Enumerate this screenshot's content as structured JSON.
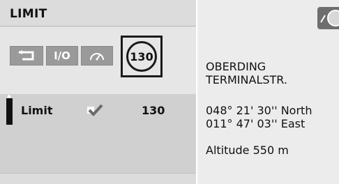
{
  "header": {
    "title": "LIMIT"
  },
  "controls": {
    "io_label": "I/O",
    "sign_value": "130"
  },
  "limit_row": {
    "label": "Limit",
    "value": "130",
    "checked": true
  },
  "location": {
    "street_line1": "OBERDING",
    "street_line2": "TERMINALSTR.",
    "latitude": "048° 21' 30'' North",
    "longitude": "011° 47' 03'' East",
    "altitude": "Altitude 550 m"
  },
  "icons": {
    "back": "back-arrow-icon",
    "speedometer": "speedometer-icon",
    "check": "checkmark-icon",
    "compass": "compass-icon"
  }
}
